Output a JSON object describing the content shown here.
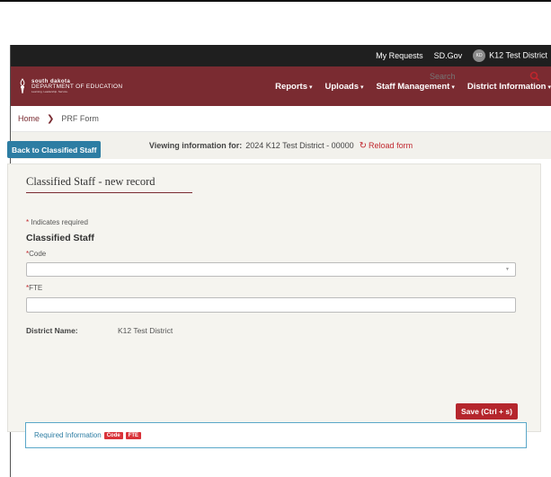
{
  "utility_bar": {
    "my_requests": "My Requests",
    "sd_gov": "SD.Gov",
    "avatar_initials": "KD",
    "user": "K12 Test District"
  },
  "brand": {
    "line1": "south dakota",
    "line2": "DEPARTMENT OF EDUCATION",
    "line3": "Learning. Leadership. Service."
  },
  "nav": {
    "items": [
      {
        "label": "Reports"
      },
      {
        "label": "Uploads"
      },
      {
        "label": "Staff Management"
      },
      {
        "label": "District Information"
      }
    ],
    "caret": "▾"
  },
  "breadcrumb": {
    "home": "Home",
    "separator": "❯",
    "current": "PRF Form"
  },
  "search": {
    "placeholder": "Search",
    "icon": "search-icon"
  },
  "viewing": {
    "label": "Viewing information for:",
    "district": "2024 K12 Test District - 00000",
    "reload": "Reload form",
    "reload_icon": "↻"
  },
  "back_button": "Back to Classified Staff",
  "form": {
    "title": "Classified Staff - new record",
    "required_note": "Indicates required",
    "required_star": "*",
    "section_title": "Classified Staff",
    "code_label": "Code",
    "code_value": "",
    "fte_label": "FTE",
    "fte_value": "",
    "district_name_label": "District Name:",
    "district_name_value": "K12 Test District",
    "save_button": "Save (Ctrl + s)"
  },
  "required_info": {
    "label": "Required Information",
    "tags": [
      "Code",
      "FTE"
    ]
  },
  "colors": {
    "brand_maroon": "#7a2b31",
    "accent_blue": "#2d7da3",
    "save_red": "#b5262d",
    "tag_red": "#d9333a"
  }
}
